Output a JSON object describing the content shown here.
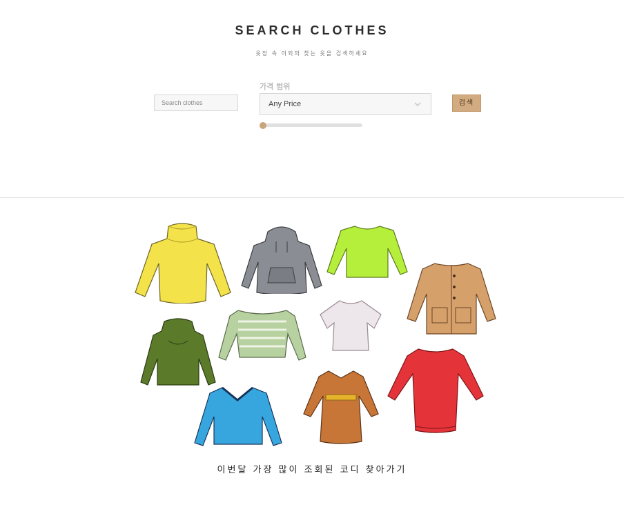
{
  "header": {
    "title": "SEARCH CLOTHES",
    "subtitle": "옷장 속 이외의 찾는 옷을 검색하세요"
  },
  "search": {
    "placeholder": "Search clothes",
    "price_label": "가격 범위",
    "price_value": "Any Price",
    "slider_level": 0,
    "button_label": "검색"
  },
  "gallery": {
    "items": [
      {
        "name": "yellow turtleneck sweater",
        "color": "#f3e24a"
      },
      {
        "name": "grey hoodie",
        "color": "#8a8d93"
      },
      {
        "name": "lime long-sleeve top",
        "color": "#b6ee3c"
      },
      {
        "name": "tan cardigan",
        "color": "#d6a06b"
      },
      {
        "name": "green cowl-neck sweater",
        "color": "#5b7a2a"
      },
      {
        "name": "striped off-shoulder top",
        "color": "#b8d1a0"
      },
      {
        "name": "white short-sleeve blouse",
        "color": "#ede6ea"
      },
      {
        "name": "red dress",
        "color": "#e5333a"
      },
      {
        "name": "blue v-neck sweater",
        "color": "#38a6de"
      },
      {
        "name": "brown wrap coat",
        "color": "#c87638"
      }
    ]
  },
  "cta_text": "이번달 가장 많이 조회된 코디 찾아가기",
  "colors": {
    "accent": "#d2ab80",
    "slider_thumb": "#c9a57d"
  }
}
